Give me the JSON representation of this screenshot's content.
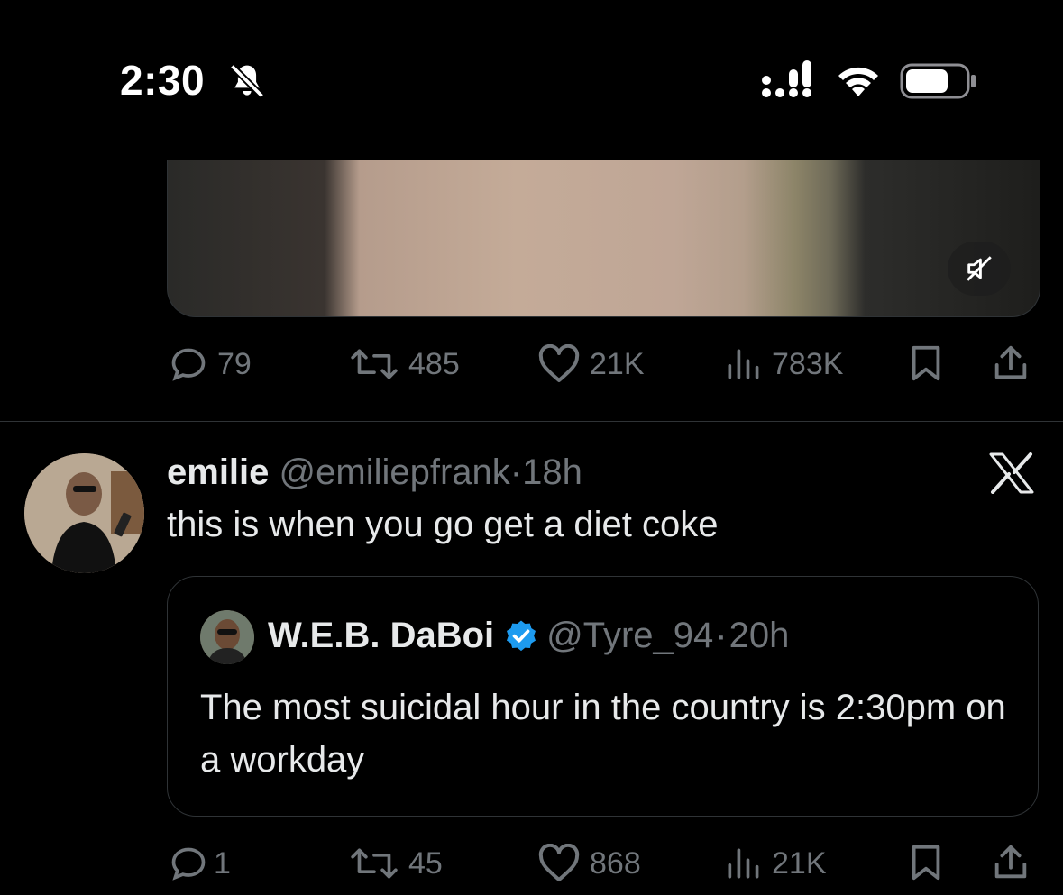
{
  "status_bar": {
    "time": "2:30",
    "silent_icon": "bell-slash-icon",
    "signal_icon": "cellular-signal-icon",
    "wifi_icon": "wifi-icon",
    "battery_icon": "battery-icon"
  },
  "previous_tweet": {
    "media": {
      "type": "video",
      "mute_icon": "speaker-muted-icon"
    },
    "actions": {
      "replies": "79",
      "reposts": "485",
      "likes": "21K",
      "views": "783K"
    }
  },
  "tweet": {
    "name": "emilie",
    "handle": "@emiliepfrank",
    "separator": "·",
    "time": "18h",
    "text": "this is when you go get a diet coke",
    "badge_icon": "x-logo-icon",
    "quote": {
      "name": "W.E.B. DaBoi",
      "verified": true,
      "handle": "@Tyre_94",
      "separator": "·",
      "time": "20h",
      "text": "The most suicidal hour in the country is 2:30pm on a workday"
    },
    "actions": {
      "replies": "1",
      "reposts": "45",
      "likes": "868",
      "views": "21K"
    }
  },
  "colors": {
    "background": "#000000",
    "text_primary": "#e7e9ea",
    "text_secondary": "#71767b",
    "divider": "#2f3336",
    "verified": "#1d9bf0"
  }
}
